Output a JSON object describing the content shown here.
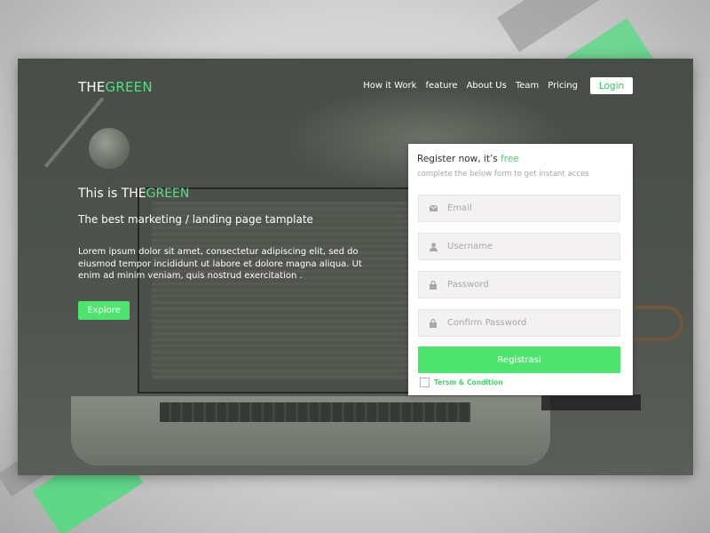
{
  "brand": {
    "logo_prefix": "THE",
    "logo_accent": "GREEN",
    "accent_color": "#55e07f"
  },
  "nav": {
    "items": [
      {
        "label": "How it Work"
      },
      {
        "label": "feature"
      },
      {
        "label": "About Us"
      },
      {
        "label": "Team"
      },
      {
        "label": "Pricing"
      }
    ],
    "login_label": "Login"
  },
  "hero": {
    "title_prefix": "This is THE",
    "title_accent": "GREEN",
    "subtitle": "The best marketing / landing page tamplate",
    "body": "Lorem ipsum dolor sit amet, consectetur adipiscing elit, sed do eiusmod tempor incididunt ut labore et dolore magna aliqua. Ut enim ad minim veniam, quis nostrud exercitation .",
    "explore_label": "Explore"
  },
  "register": {
    "title_prefix": "Register now, it’s ",
    "title_accent": "free",
    "subtitle": "complete the below form to get instant acces",
    "fields": [
      {
        "placeholder": "Email",
        "icon": "envelope-icon"
      },
      {
        "placeholder": "Username",
        "icon": "user-icon"
      },
      {
        "placeholder": "Password",
        "icon": "lock-icon"
      },
      {
        "placeholder": "Confirm Password",
        "icon": "lock-icon"
      }
    ],
    "submit_label": "Registrasi",
    "terms_label": "Tersm & Condition",
    "terms_checked": false
  }
}
